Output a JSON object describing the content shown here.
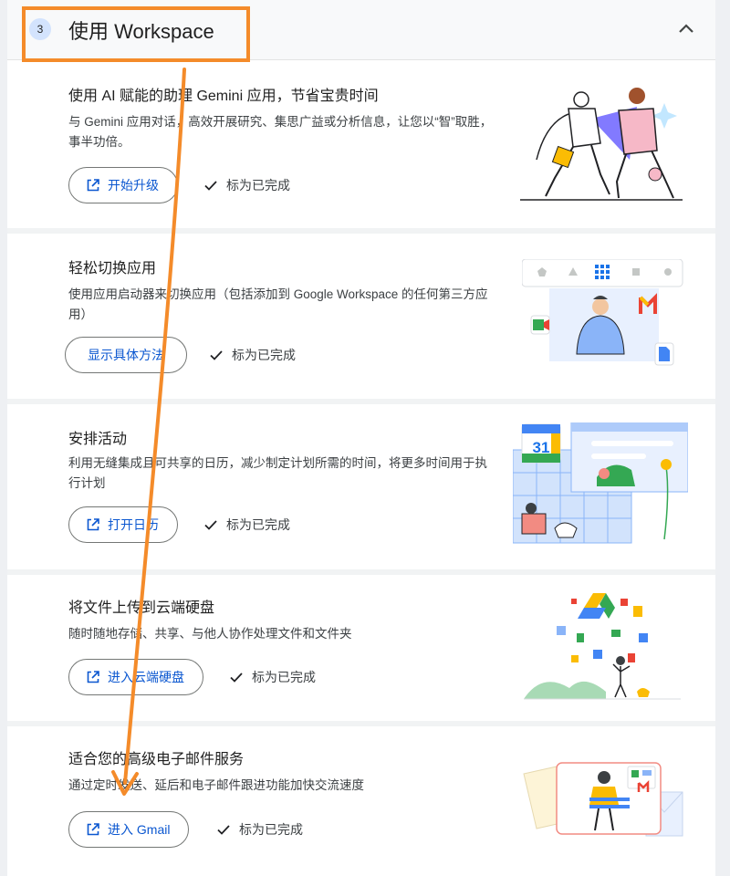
{
  "section": {
    "step_number": "3",
    "title": "使用 Workspace"
  },
  "cards": [
    {
      "title": "使用 AI 赋能的助理 Gemini 应用，节省宝贵时间",
      "description": "与 Gemini 应用对话，高效开展研究、集思广益或分析信息，让您以“智”取胜，事半功倍。",
      "action_label": "开始升级",
      "action_icon": "external-link-icon",
      "complete_label": "标为已完成"
    },
    {
      "title": "轻松切换应用",
      "description": "使用应用启动器来切换应用（包括添加到 Google Workspace 的任何第三方应用）",
      "action_label": "显示具体方法",
      "complete_label": "标为已完成"
    },
    {
      "title": "安排活动",
      "description": "利用无缝集成且可共享的日历，减少制定计划所需的时间，将更多时间用于执行计划",
      "action_label": "打开日历",
      "action_icon": "external-link-icon",
      "calendar_day": "31",
      "complete_label": "标为已完成"
    },
    {
      "title": "将文件上传到云端硬盘",
      "description": "随时随地存储、共享、与他人协作处理文件和文件夹",
      "action_label": "进入云端硬盘",
      "action_icon": "external-link-icon",
      "complete_label": "标为已完成"
    },
    {
      "title": "适合您的高级电子邮件服务",
      "description": "通过定时发送、延后和电子邮件跟进功能加快交流速度",
      "action_label": "进入 Gmail",
      "action_icon": "external-link-icon",
      "complete_label": "标为已完成"
    }
  ],
  "colors": {
    "accent_blue": "#0b57d0",
    "annotation_orange": "#f48b2a",
    "google_blue": "#4285f4",
    "google_red": "#ea4335",
    "google_yellow": "#fbbc04",
    "google_green": "#34a853"
  }
}
